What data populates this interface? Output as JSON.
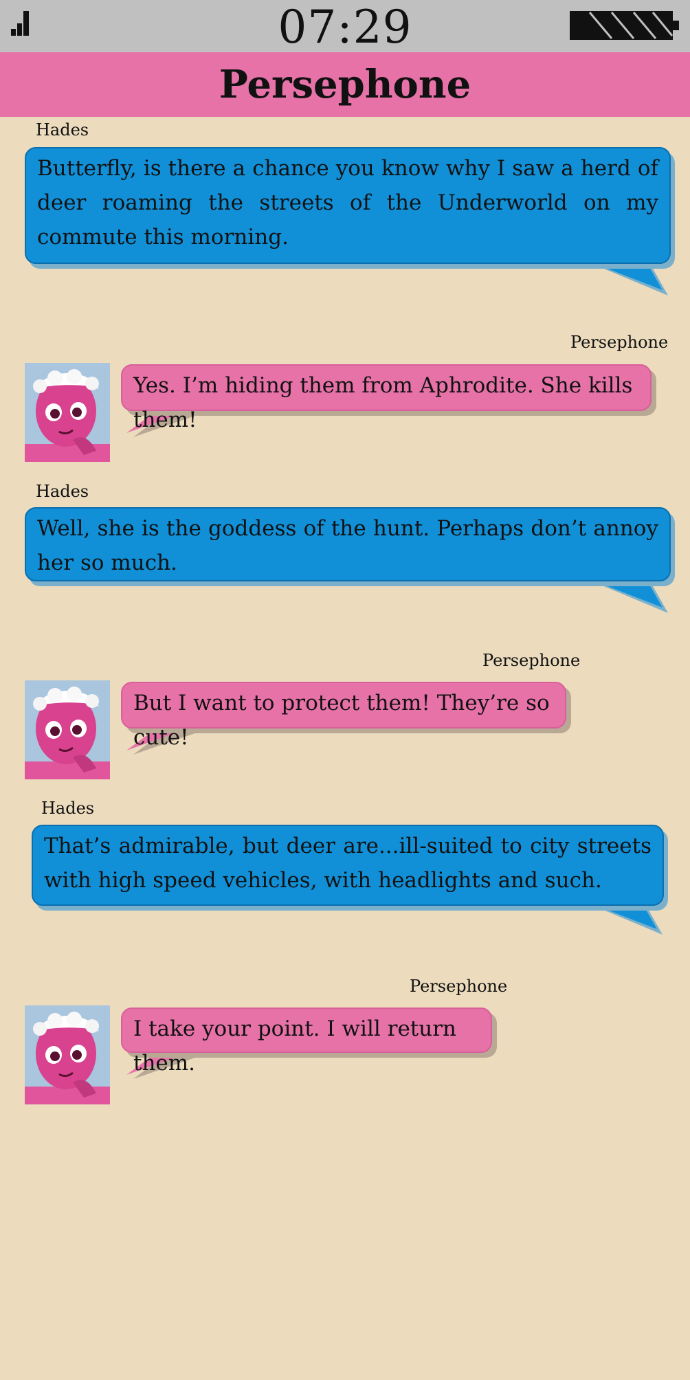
{
  "status_bar": {
    "time": "07:29",
    "signal_icon": "signal-strength-icon",
    "battery_icon": "battery-icon"
  },
  "header": {
    "contact_name": "Persephone"
  },
  "colors": {
    "background": "#ecdcbd",
    "status_bar": "#c0c0c0",
    "header": "#e672a8",
    "hades_bubble": "#1190d8",
    "persephone_bubble": "#e672a8"
  },
  "messages": [
    {
      "sender": "Hades",
      "text": "Butterfly, is there a chance you know why I saw a herd of deer roaming the streets of the Underworld on my commute this morn­ing."
    },
    {
      "sender": "Persephone",
      "text": "Yes.  I’m hiding them from Aphrodite.  She kills them!"
    },
    {
      "sender": "Hades",
      "text": "Well, she is the goddess of the hunt.  Perhaps don’t annoy her so much."
    },
    {
      "sender": "Persephone",
      "text": "But I want to protect them!  They’re so cute!"
    },
    {
      "sender": "Hades",
      "text": "That’s admirable, but deer are...ill-suited to city streets with high speed vehicles, with headlights and such."
    },
    {
      "sender": "Persephone",
      "text": "I take your point.  I will return them."
    }
  ]
}
